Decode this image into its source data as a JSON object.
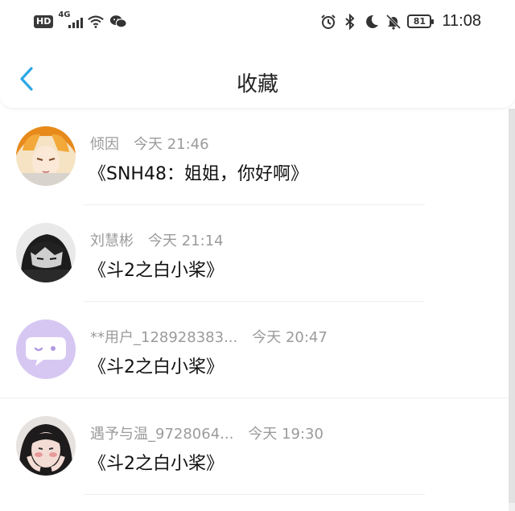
{
  "status_bar": {
    "hd": "HD",
    "network": "4G",
    "battery": "81",
    "time": "11:08"
  },
  "header": {
    "title": "收藏",
    "back_icon": "chevron-left-icon"
  },
  "favorites": [
    {
      "name": "倾因",
      "time": "今天 21:46",
      "content": "《SNH48：姐姐，你好啊》"
    },
    {
      "name": "刘慧彬",
      "time": "今天 21:14",
      "content": "《斗2之白小桨》"
    },
    {
      "name": "**用户_128928383...",
      "time": "今天 20:47",
      "content": "《斗2之白小桨》"
    },
    {
      "name": "遇予与温_9728064...",
      "time": "今天 19:30",
      "content": "《斗2之白小桨》"
    }
  ],
  "colors": {
    "accent": "#2aa7e6",
    "meta_text": "#9b9b9b",
    "placeholder_avatar": "#d6c7f2"
  }
}
